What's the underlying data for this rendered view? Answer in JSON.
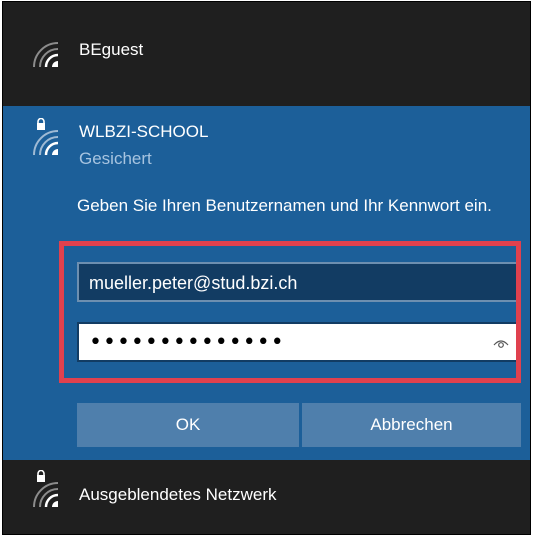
{
  "networks": {
    "guest": {
      "name": "BEguest",
      "icon": "wifi-icon"
    },
    "school": {
      "name": "WLBZI-SCHOOL",
      "status": "Gesichert",
      "icon": "wifi-icon",
      "lock_icon": "lock-icon",
      "prompt": "Geben Sie Ihren Benutzernamen und Ihr Kennwort ein.",
      "username_value": "mueller.peter@stud.bzi.ch",
      "password_mask": "••••••••••••••",
      "reveal_icon": "eye-icon",
      "ok_label": "OK",
      "cancel_label": "Abbrechen"
    },
    "hidden": {
      "name": "Ausgeblendetes Netzwerk",
      "icon": "wifi-icon",
      "lock_icon": "lock-icon"
    }
  },
  "colors": {
    "panel_bg": "#1f1f1f",
    "active_bg": "#1c5f99",
    "button_bg": "#4f7fac",
    "highlight_border": "#e0414e",
    "input_dark": "#123c63"
  }
}
